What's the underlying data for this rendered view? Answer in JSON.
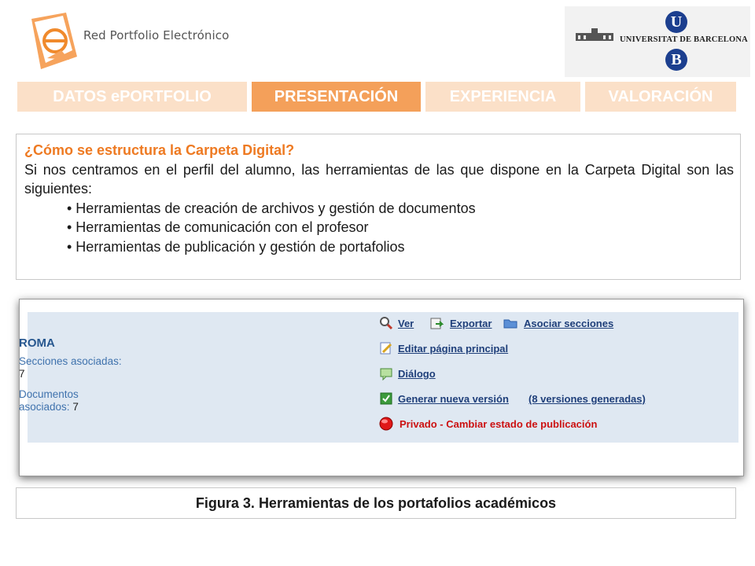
{
  "header": {
    "brand_text": "Red Portfolio Electrónico",
    "university_name": "UNIVERSITAT DE BARCELONA",
    "ub_letters": [
      "U",
      "B"
    ],
    "brand_color": "#f4a05a"
  },
  "tabs": [
    {
      "label": "DATOS ePORTFOLIO",
      "active": false
    },
    {
      "label": "PRESENTACIÓN",
      "active": true
    },
    {
      "label": "EXPERIENCIA",
      "active": false
    },
    {
      "label": "VALORACIÓN",
      "active": false
    }
  ],
  "content": {
    "question": "¿Cómo se estructura la Carpeta Digital?",
    "intro": "Si nos centramos en el perfil del alumno, las herramientas de las que dispone en la Carpeta Digital son las siguientes:",
    "bullets": [
      "• Herramientas de creación de archivos y gestión de documentos",
      "• Herramientas de comunicación con el profesor",
      "• Herramientas de publicación y gestión de portafolios"
    ]
  },
  "screenshot": {
    "portfolio_title": "ROMA",
    "sections_label": "Secciones asociadas:",
    "sections_value": "7",
    "documents_label": "Documentos asociados:",
    "documents_value": "7",
    "actions": {
      "view": "Ver",
      "export": "Exportar",
      "associate": "Asociar secciones",
      "edit": "Editar página principal",
      "dialog": "Diálogo",
      "new_version": "Generar nueva versión",
      "versions": "(8 versiones generadas)",
      "private": "Privado - Cambiar estado de publicación"
    }
  },
  "caption": "Figura 3.  Herramientas de los portafolios académicos"
}
